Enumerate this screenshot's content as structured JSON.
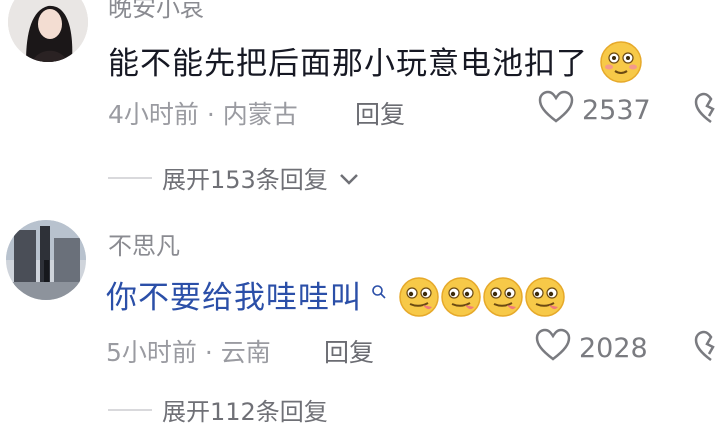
{
  "comments": [
    {
      "username": "晚安小哀",
      "text": "能不能先把后面那小玩意电池扣了",
      "time_location": "4小时前 · 内蒙古",
      "reply_label": "回复",
      "likes": "2537",
      "expand_label": "展开153条回复"
    },
    {
      "username": "不思凡",
      "text": "你不要给我哇哇叫",
      "time_location": "5小时前 · 云南",
      "reply_label": "回复",
      "likes": "2028",
      "expand_label": "展开112条回复"
    }
  ],
  "colors": {
    "link_text": "#2b4fa8",
    "emoji_yellow": "#f7c948"
  },
  "icons": [
    "heart-icon",
    "broken-heart-icon",
    "chevron-down-icon",
    "search-icon",
    "emoji-icon"
  ]
}
